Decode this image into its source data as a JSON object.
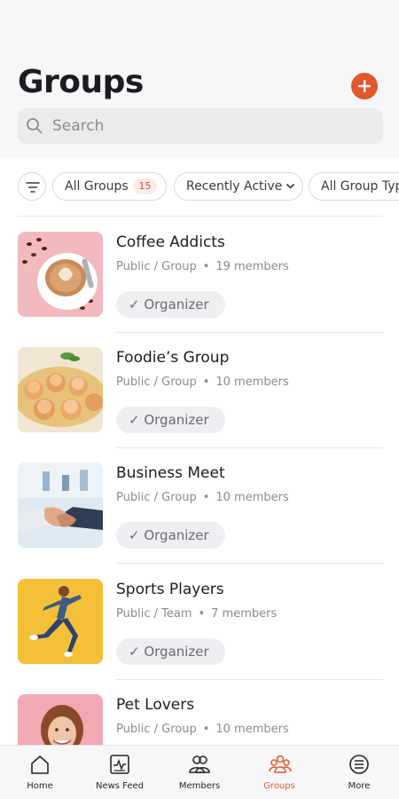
{
  "header": {
    "title": "Groups",
    "search_placeholder": "Search"
  },
  "filters": {
    "all_groups_label": "All Groups",
    "all_groups_count": "15",
    "recently_active_label": "Recently Active",
    "group_type_label": "All Group Typ"
  },
  "groups": [
    {
      "name": "Coffee Addicts",
      "visibility": "Public / Group",
      "members": "19 members",
      "role": "✓ Organizer",
      "thumb_icon": "coffee-cup-thumbnail"
    },
    {
      "name": "Foodie’s Group",
      "visibility": "Public / Group",
      "members": "10 members",
      "role": "✓ Organizer",
      "thumb_icon": "food-plate-thumbnail"
    },
    {
      "name": "Business Meet",
      "visibility": "Public / Group",
      "members": "10 members",
      "role": "✓ Organizer",
      "thumb_icon": "handshake-thumbnail"
    },
    {
      "name": "Sports Players",
      "visibility": "Public / Team",
      "members": "7 members",
      "role": "✓ Organizer",
      "thumb_icon": "runner-thumbnail"
    },
    {
      "name": "Pet Lovers",
      "visibility": "Public / Group",
      "members": "10 members",
      "role": "",
      "thumb_icon": "person-with-pet-thumbnail"
    }
  ],
  "nav": {
    "items": [
      {
        "label": "Home",
        "icon": "home-icon"
      },
      {
        "label": "News Feed",
        "icon": "news-feed-icon"
      },
      {
        "label": "Members",
        "icon": "members-icon"
      },
      {
        "label": "Groups",
        "icon": "groups-icon",
        "active": true
      },
      {
        "label": "More",
        "icon": "more-menu-icon"
      }
    ]
  },
  "colors": {
    "accent": "#e2572f",
    "text_primary": "#1c1c21",
    "text_secondary": "#8a8a92",
    "pill_bg": "#efeff3"
  }
}
